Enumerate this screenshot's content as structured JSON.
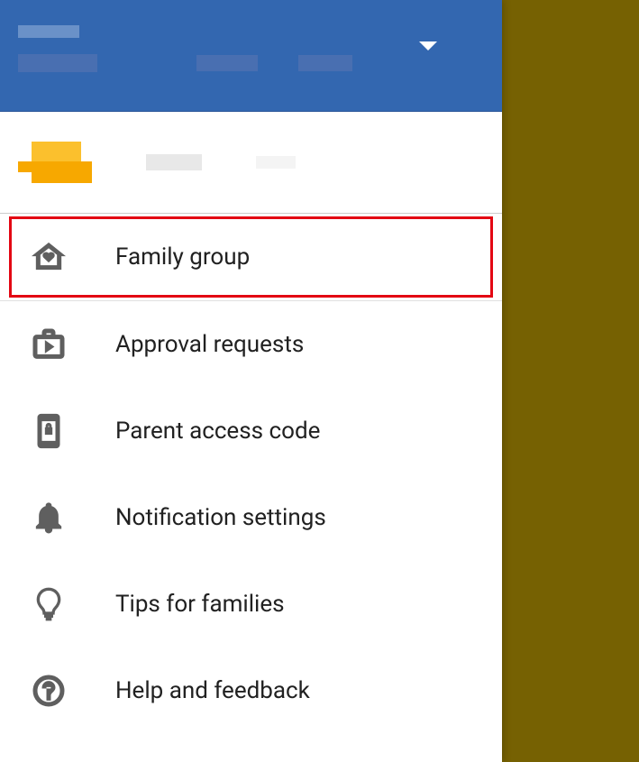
{
  "menu": {
    "items": [
      {
        "label": "Family group"
      },
      {
        "label": "Approval requests"
      },
      {
        "label": "Parent access code"
      },
      {
        "label": "Notification settings"
      },
      {
        "label": "Tips for families"
      },
      {
        "label": "Help and feedback"
      }
    ]
  }
}
